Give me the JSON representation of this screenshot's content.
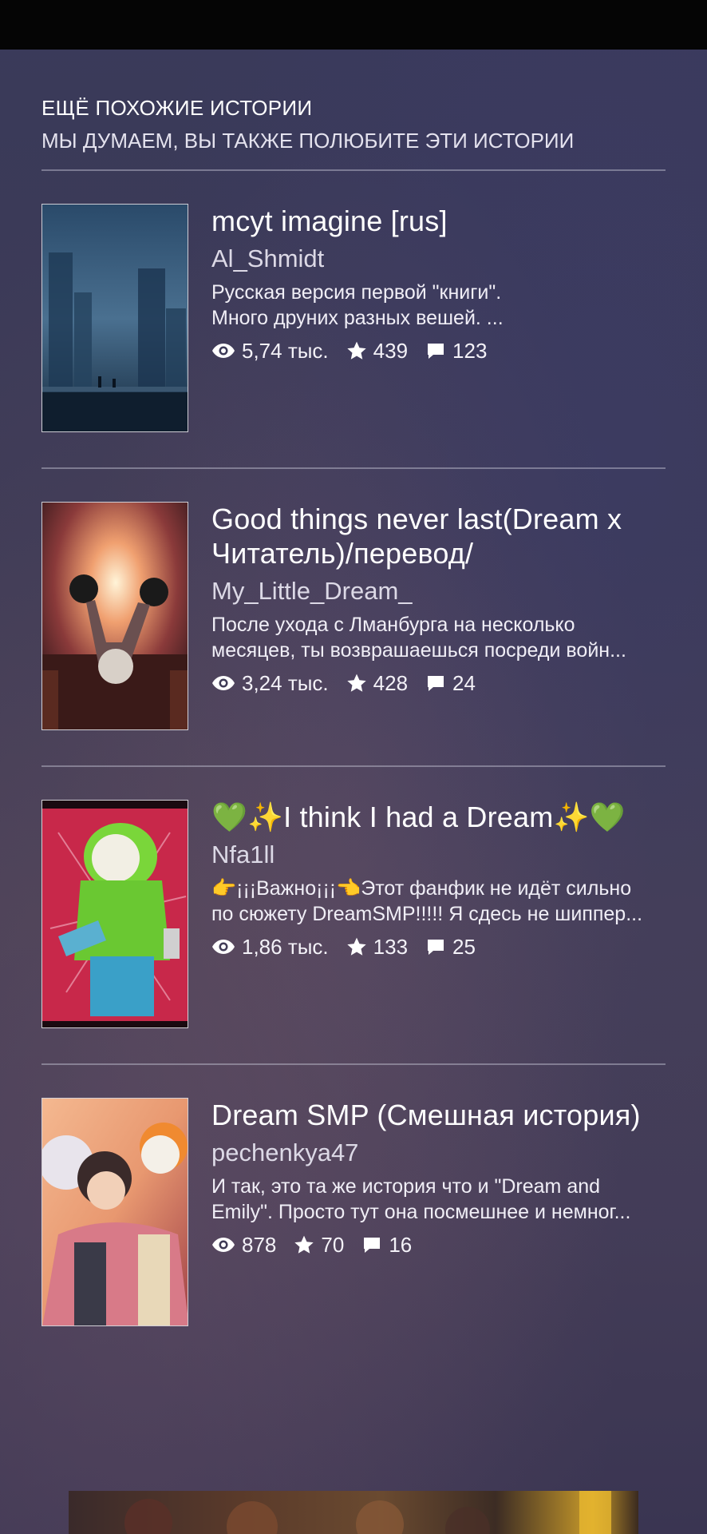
{
  "section": {
    "title": "ЕЩЁ ПОХОЖИЕ ИСТОРИИ",
    "subtitle": "МЫ ДУМАЕМ, ВЫ ТАКЖЕ ПОЛЮБИТЕ ЭТИ ИСТОРИИ"
  },
  "icons": {
    "reads": "eye-icon",
    "votes": "star-icon",
    "comments": "comment-icon",
    "heart": "green-heart-emoji",
    "sparkles": "sparkles-emoji"
  },
  "stories": [
    {
      "title": "mcyt imagine [rus]",
      "author": "Al_Shmidt",
      "description": [
        "Русская версия первой \"книги\".",
        "Много друних разных вешей. ..."
      ],
      "reads": "5,74 тыс.",
      "votes": "439",
      "comments": "123"
    },
    {
      "title_lines": [
        "Good things never last(Dream x",
        "Читатель)/перевод/"
      ],
      "author": "My_Little_Dream_",
      "description": [
        "После ухода с Лманбурга на несколько",
        "месяцев, ты возврашаешься посреди войн..."
      ],
      "reads": "3,24 тыс.",
      "votes": "428",
      "comments": "24"
    },
    {
      "title": "I think I had a Dream",
      "author": "Nfa1ll",
      "description": [
        "👉¡¡¡Важно¡¡¡👈Этот фанфик не идёт сильно",
        "по сюжету DreamSMP!!!!! Я сдесь не шиппер..."
      ],
      "reads": "1,86 тыс.",
      "votes": "133",
      "comments": "25"
    },
    {
      "title": "Dream SMP (Смешная история)",
      "author": "pechenkya47",
      "description": [
        "И так, это та же история что и \"Dream and",
        "Emily\". Просто тут она посмешнее и немног..."
      ],
      "reads": "878",
      "votes": "70",
      "comments": "16"
    }
  ]
}
